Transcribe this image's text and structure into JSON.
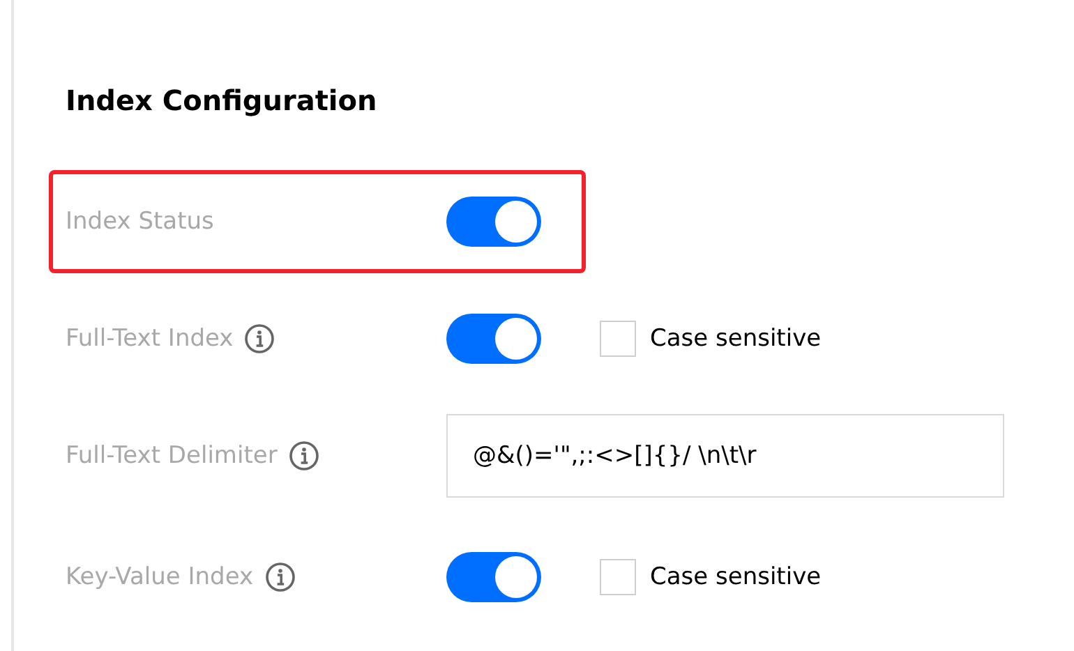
{
  "title": "Index Configuration",
  "rows": [
    {
      "kind": "toggle",
      "label": "Index Status",
      "info_icon": false,
      "highlighted": true,
      "on": true
    },
    {
      "kind": "toggle",
      "label": "Full-Text Index",
      "info_icon": true,
      "highlighted": false,
      "on": true,
      "checkbox": {
        "label": "Case sensitive",
        "checked": false
      }
    },
    {
      "kind": "input",
      "label": "Full-Text Delimiter",
      "info_icon": true,
      "highlighted": false,
      "value": "@&()='\",;:<>[]{}/ \\n\\t\\r"
    },
    {
      "kind": "toggle",
      "label": "Key-Value Index",
      "info_icon": true,
      "highlighted": false,
      "on": true,
      "checkbox": {
        "label": "Case sensitive",
        "checked": false
      }
    }
  ]
}
